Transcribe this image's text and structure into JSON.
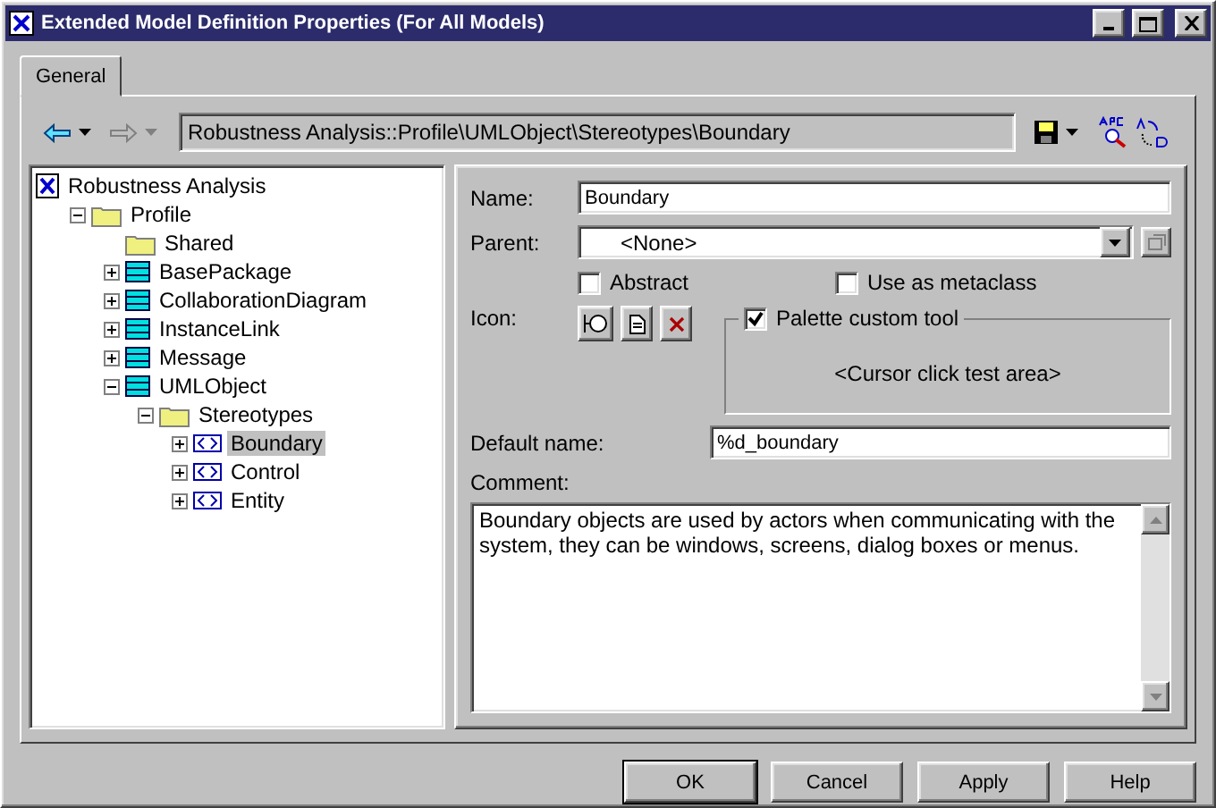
{
  "window": {
    "title": "Extended Model Definition Properties (For All Models)"
  },
  "tabs": [
    {
      "label": "General",
      "selected": true
    }
  ],
  "toolbar": {
    "path": "Robustness Analysis::Profile\\UMLObject\\Stereotypes\\Boundary"
  },
  "tree": [
    {
      "label": "Robustness Analysis",
      "kind": "model",
      "selected": false,
      "children": [
        {
          "label": "Profile",
          "kind": "folder",
          "expanded": true,
          "selected": false,
          "children": [
            {
              "label": "Shared",
              "kind": "folder",
              "selected": false
            },
            {
              "label": "BasePackage",
              "kind": "package",
              "expanded": false,
              "selected": false
            },
            {
              "label": "CollaborationDiagram",
              "kind": "package",
              "expanded": false,
              "selected": false
            },
            {
              "label": "InstanceLink",
              "kind": "package",
              "expanded": false,
              "selected": false
            },
            {
              "label": "Message",
              "kind": "package",
              "expanded": false,
              "selected": false
            },
            {
              "label": "UMLObject",
              "kind": "package",
              "expanded": true,
              "selected": false,
              "children": [
                {
                  "label": "Stereotypes",
                  "kind": "folder",
                  "expanded": true,
                  "selected": false,
                  "children": [
                    {
                      "label": "Boundary",
                      "kind": "stereotype",
                      "expanded": false,
                      "selected": true
                    },
                    {
                      "label": "Control",
                      "kind": "stereotype",
                      "expanded": false,
                      "selected": false
                    },
                    {
                      "label": "Entity",
                      "kind": "stereotype",
                      "expanded": false,
                      "selected": false
                    }
                  ]
                }
              ]
            }
          ]
        }
      ]
    }
  ],
  "form": {
    "name": {
      "label": "Name:",
      "value": "Boundary"
    },
    "parent": {
      "label": "Parent:",
      "value": "<None>"
    },
    "checkboxes": [
      {
        "label": "Abstract",
        "checked": false
      },
      {
        "label": "Use as metaclass",
        "checked": false
      }
    ],
    "icon_label": "Icon:",
    "palette": {
      "label": "Palette custom tool",
      "checked": true,
      "area": "<Cursor click test area>"
    },
    "default_name": {
      "label": "Default name:",
      "value": "%d_boundary"
    },
    "comment": {
      "label": "Comment:",
      "value": "Boundary objects are used by actors when communicating with the system, they can be windows, screens, dialog boxes or menus."
    }
  },
  "buttons": [
    {
      "label": "OK",
      "default": true
    },
    {
      "label": "Cancel",
      "default": false
    },
    {
      "label": "Apply",
      "default": false
    },
    {
      "label": "Help",
      "default": false
    }
  ]
}
